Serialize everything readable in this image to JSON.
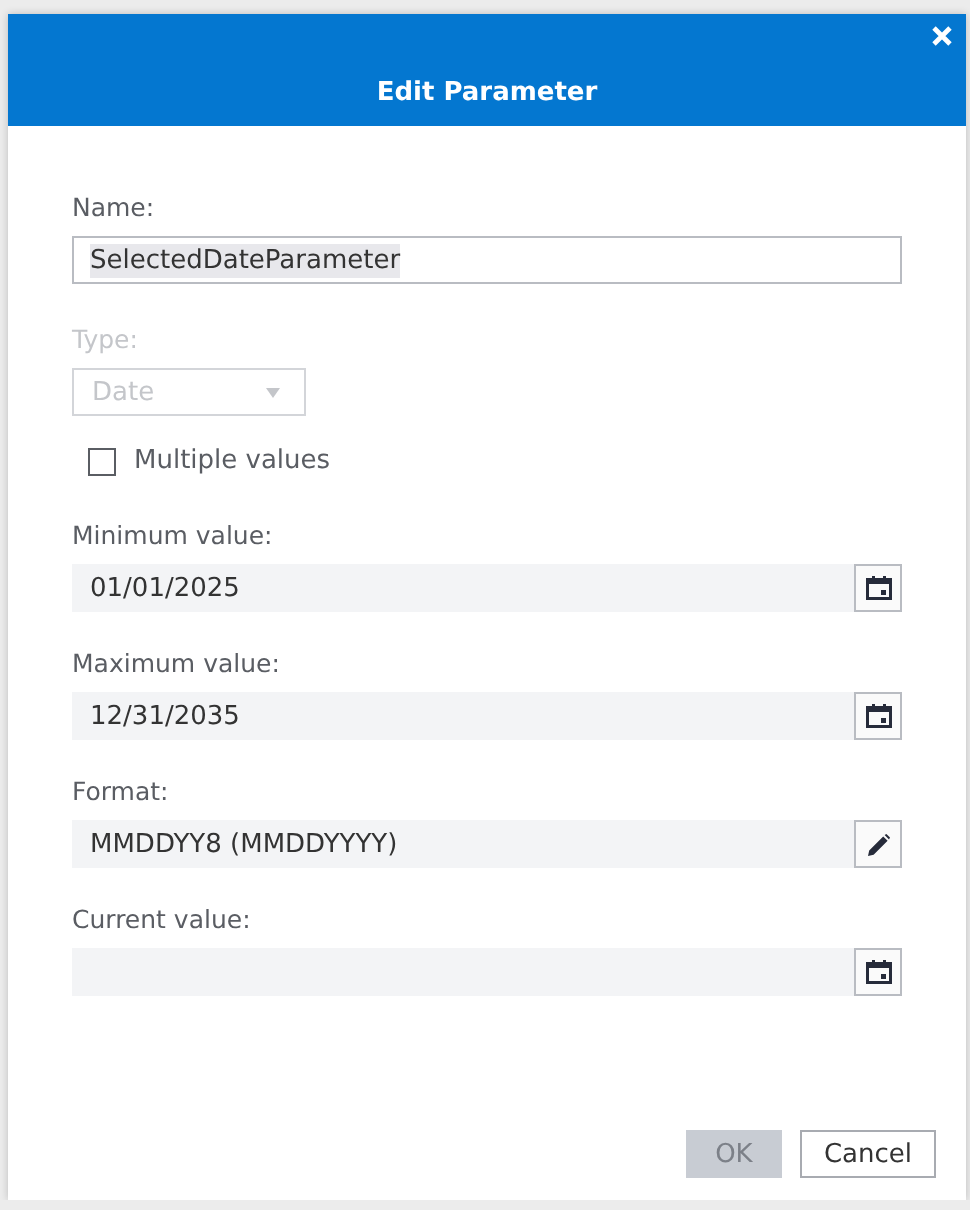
{
  "dialog": {
    "title": "Edit Parameter"
  },
  "fields": [
    {
      "kind": "text",
      "label": "Name:",
      "value": "SelectedDateParameter",
      "text_selected": true,
      "disabled": false
    },
    {
      "kind": "select",
      "label": "Type:",
      "value": "Date",
      "disabled": true
    },
    {
      "kind": "checkbox",
      "label": "Multiple values",
      "checked": false
    },
    {
      "kind": "date",
      "label": "Minimum value:",
      "value": "01/01/2025"
    },
    {
      "kind": "date",
      "label": "Maximum value:",
      "value": "12/31/2035"
    },
    {
      "kind": "format",
      "label": "Format:",
      "value": "MMDDYY8 (MMDDYYYY)"
    },
    {
      "kind": "date",
      "label": "Current value:"
    }
  ],
  "buttons": [
    {
      "label": "OK",
      "disabled": true
    },
    {
      "label": "Cancel",
      "disabled": false
    }
  ]
}
